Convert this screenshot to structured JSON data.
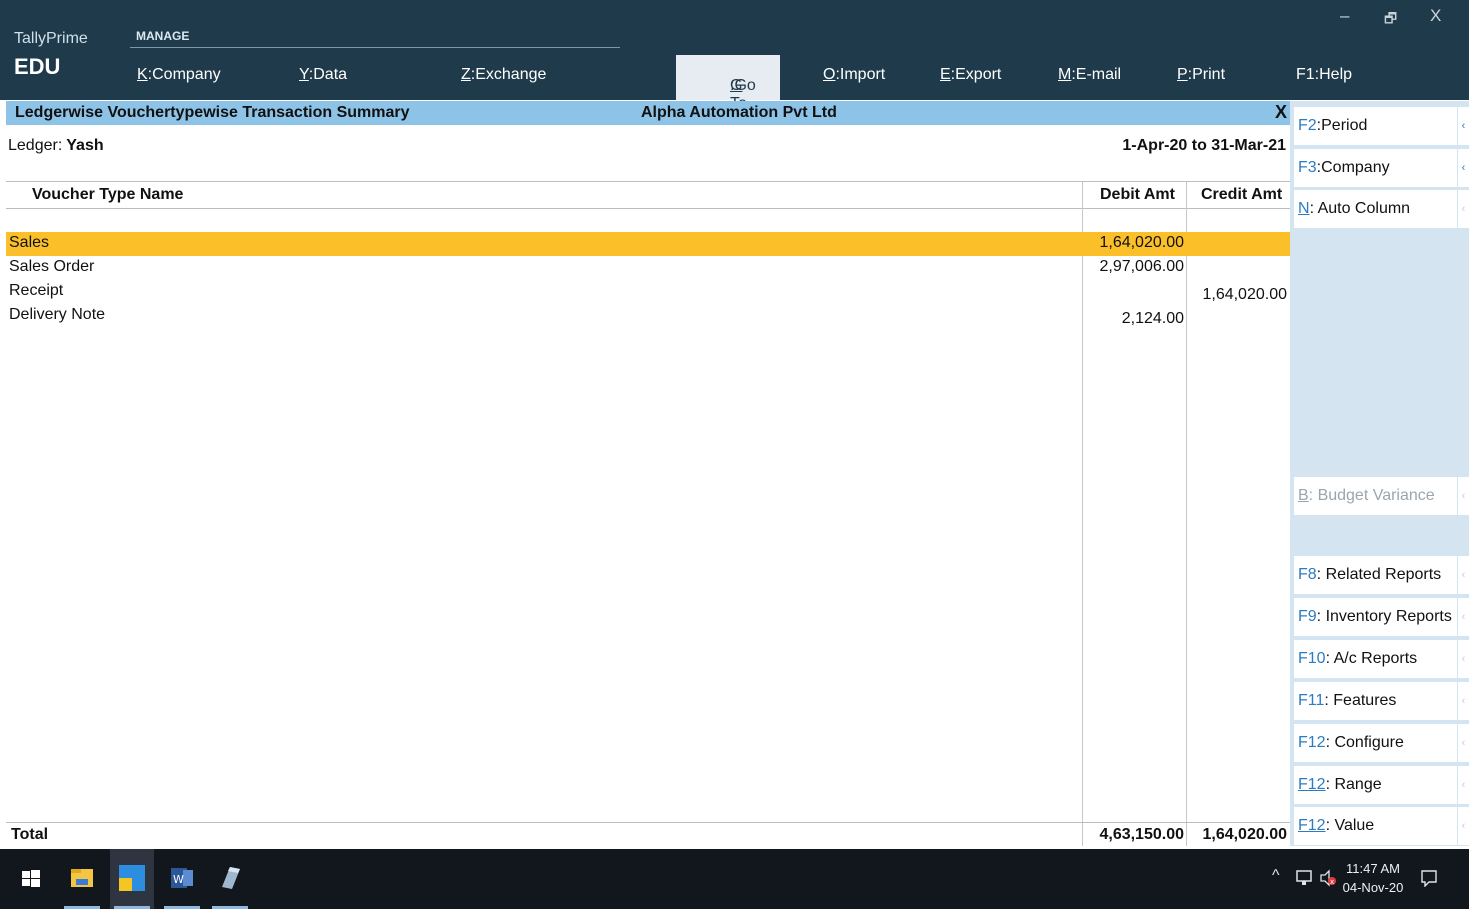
{
  "app": {
    "brand": "TallyPrime",
    "edition": "EDU",
    "manage_label": "MANAGE",
    "window_controls": {
      "minimize": "–",
      "restore": "🗗",
      "close": "X"
    }
  },
  "menu": {
    "company": {
      "key": "K",
      "label": ":Company"
    },
    "data": {
      "key": "Y",
      "label": ":Data"
    },
    "exchange": {
      "key": "Z",
      "label": ":Exchange"
    },
    "goto": {
      "key": "G",
      "label": ":Go To"
    },
    "import": {
      "key": "O",
      "label": ":Import"
    },
    "export": {
      "key": "E",
      "label": ":Export"
    },
    "email": {
      "key": "M",
      "label": ":E-mail"
    },
    "print": {
      "key": "P",
      "label": ":Print"
    },
    "help": {
      "key": "F1",
      "label": ":Help"
    }
  },
  "report": {
    "title": "Ledgerwise Vouchertypewise Transaction Summary",
    "company": "Alpha Automation Pvt Ltd",
    "close": "X",
    "ledger_label": "Ledger:",
    "ledger_name": "Yash",
    "period": "1-Apr-20 to 31-Mar-21",
    "columns": {
      "name": "Voucher Type Name",
      "debit": "Debit Amt",
      "credit": "Credit Amt"
    },
    "rows": [
      {
        "name": "Sales",
        "debit": "1,64,020.00",
        "credit": ""
      },
      {
        "name": "Sales Order",
        "debit": "2,97,006.00",
        "credit": ""
      },
      {
        "name": "Receipt",
        "debit": "",
        "credit": "1,64,020.00"
      },
      {
        "name": "Delivery Note",
        "debit": "2,124.00",
        "credit": ""
      }
    ],
    "total": {
      "label": "Total",
      "debit": "4,63,150.00",
      "credit": "1,64,020.00"
    }
  },
  "side_buttons": {
    "period": {
      "key": "F2",
      "label": ":Period"
    },
    "company": {
      "key": "F3",
      "label": ":Company"
    },
    "auto_column": {
      "key": "N",
      "label": ": Auto Column"
    },
    "budget_variance": {
      "key": "B",
      "label": ": Budget Variance"
    },
    "related_reports": {
      "key": "F8",
      "label": ": Related Reports"
    },
    "inventory_reports": {
      "key": "F9",
      "label": ": Inventory Reports"
    },
    "ac_reports": {
      "key": "F10",
      "label": ": A/c Reports"
    },
    "features": {
      "key": "F11",
      "label": ": Features"
    },
    "configure": {
      "key": "F12",
      "label": ": Configure"
    },
    "range": {
      "key": "F12",
      "label": ": Range"
    },
    "value": {
      "key": "F12",
      "label": ": Value"
    },
    "arrow": "‹"
  },
  "taskbar": {
    "time": "11:47 AM",
    "date": "04-Nov-20",
    "tray_up": "^",
    "word_label": "W"
  }
}
